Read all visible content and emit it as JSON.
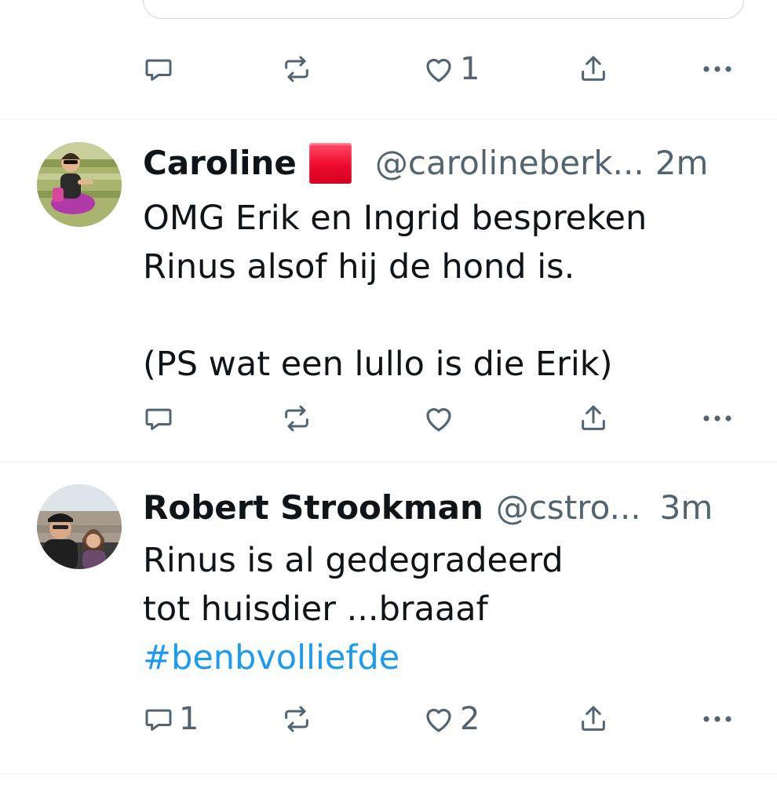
{
  "previous_tweet": {
    "actions": {
      "reply_count": "",
      "retweet_count": "",
      "like_count": "1"
    }
  },
  "tweets": [
    {
      "name": "Caroline",
      "handle": "@carolineberk...",
      "time": "2m",
      "text_lines": [
        "OMG Erik en Ingrid bespreken",
        "Rinus alsof hij de hond is.",
        "",
        "(PS wat een lullo is die Erik)"
      ],
      "actions": {
        "reply_count": "",
        "retweet_count": "",
        "like_count": ""
      }
    },
    {
      "name": "Robert Strookman",
      "handle": "@cstro...",
      "time": "3m",
      "text_lines": [
        "Rinus is al gedegradeerd",
        "tot huisdier ...braaaf"
      ],
      "hashtag": "#benbvolliefde",
      "actions": {
        "reply_count": "1",
        "retweet_count": "",
        "like_count": "2"
      }
    }
  ],
  "colors": {
    "text_primary": "#0f1419",
    "text_secondary": "#536471",
    "link": "#1d9bf0",
    "divider": "#eff3f4",
    "flag_red": "#ef0a2c"
  },
  "icons": [
    "reply-icon",
    "retweet-icon",
    "heart-icon",
    "share-icon",
    "more-icon",
    "red-square-flag-icon"
  ]
}
